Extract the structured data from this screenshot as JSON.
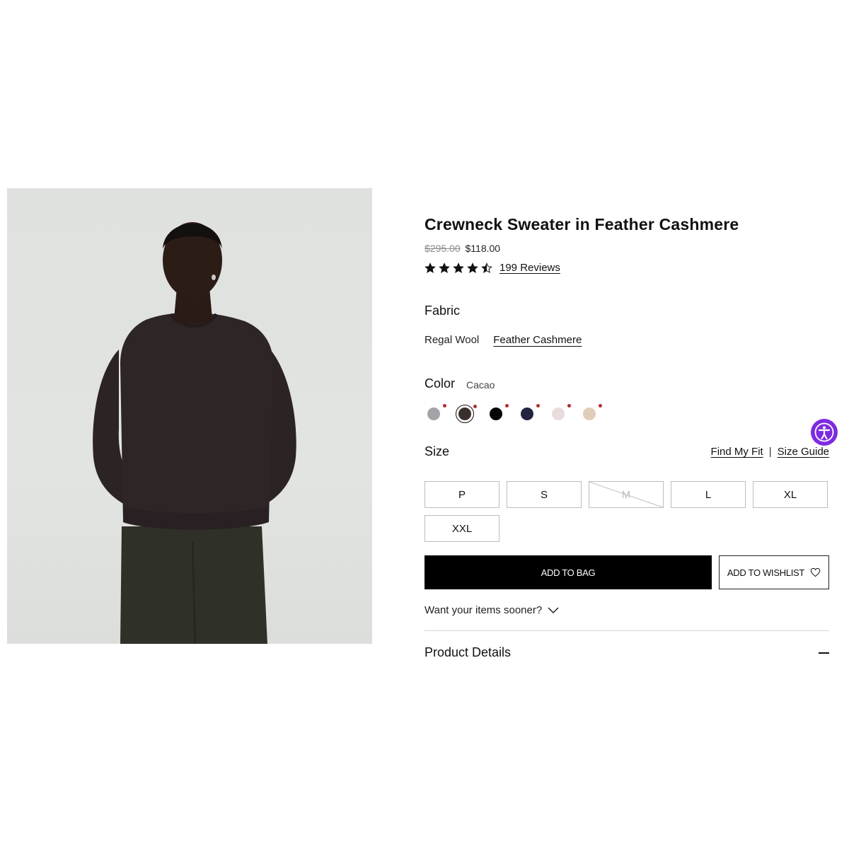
{
  "product": {
    "title": "Crewneck Sweater in Feather Cashmere",
    "original_price": "$295.00",
    "sale_price": "$118.00",
    "rating": 4.5,
    "rating_max": 5,
    "reviews_label": "199 Reviews"
  },
  "fabric": {
    "label": "Fabric",
    "options": [
      {
        "label": "Regal Wool",
        "selected": false
      },
      {
        "label": "Feather Cashmere",
        "selected": true
      }
    ]
  },
  "color": {
    "label": "Color",
    "selected_name": "Cacao",
    "swatches": [
      {
        "hex": "#a3a3a8",
        "selected": false
      },
      {
        "hex": "#3a302c",
        "selected": true
      },
      {
        "hex": "#050505",
        "selected": false
      },
      {
        "hex": "#23243f",
        "selected": false
      },
      {
        "hex": "#eadcdc",
        "selected": false
      },
      {
        "hex": "#e1cdb9",
        "selected": false
      }
    ]
  },
  "size": {
    "label": "Size",
    "find_fit_label": "Find My Fit",
    "separator": "|",
    "size_guide_label": "Size Guide",
    "options": [
      {
        "label": "P",
        "available": true
      },
      {
        "label": "S",
        "available": true
      },
      {
        "label": "M",
        "available": false
      },
      {
        "label": "L",
        "available": true
      },
      {
        "label": "XL",
        "available": true
      },
      {
        "label": "XXL",
        "available": true
      }
    ]
  },
  "actions": {
    "add_to_bag": "ADD TO BAG",
    "add_to_wishlist": "ADD TO WISHLIST"
  },
  "delivery": {
    "prompt": "Want your items sooner?"
  },
  "accordion": {
    "product_details": "Product Details"
  },
  "icons": {
    "star": "star-icon",
    "heart": "heart-icon",
    "chevron": "chevron-down-icon",
    "minus": "minus-icon",
    "accessibility": "accessibility-icon"
  },
  "colors": {
    "accent_purple": "#7e2be0",
    "swatch_dot": "#b03028",
    "button_black": "#000000"
  }
}
